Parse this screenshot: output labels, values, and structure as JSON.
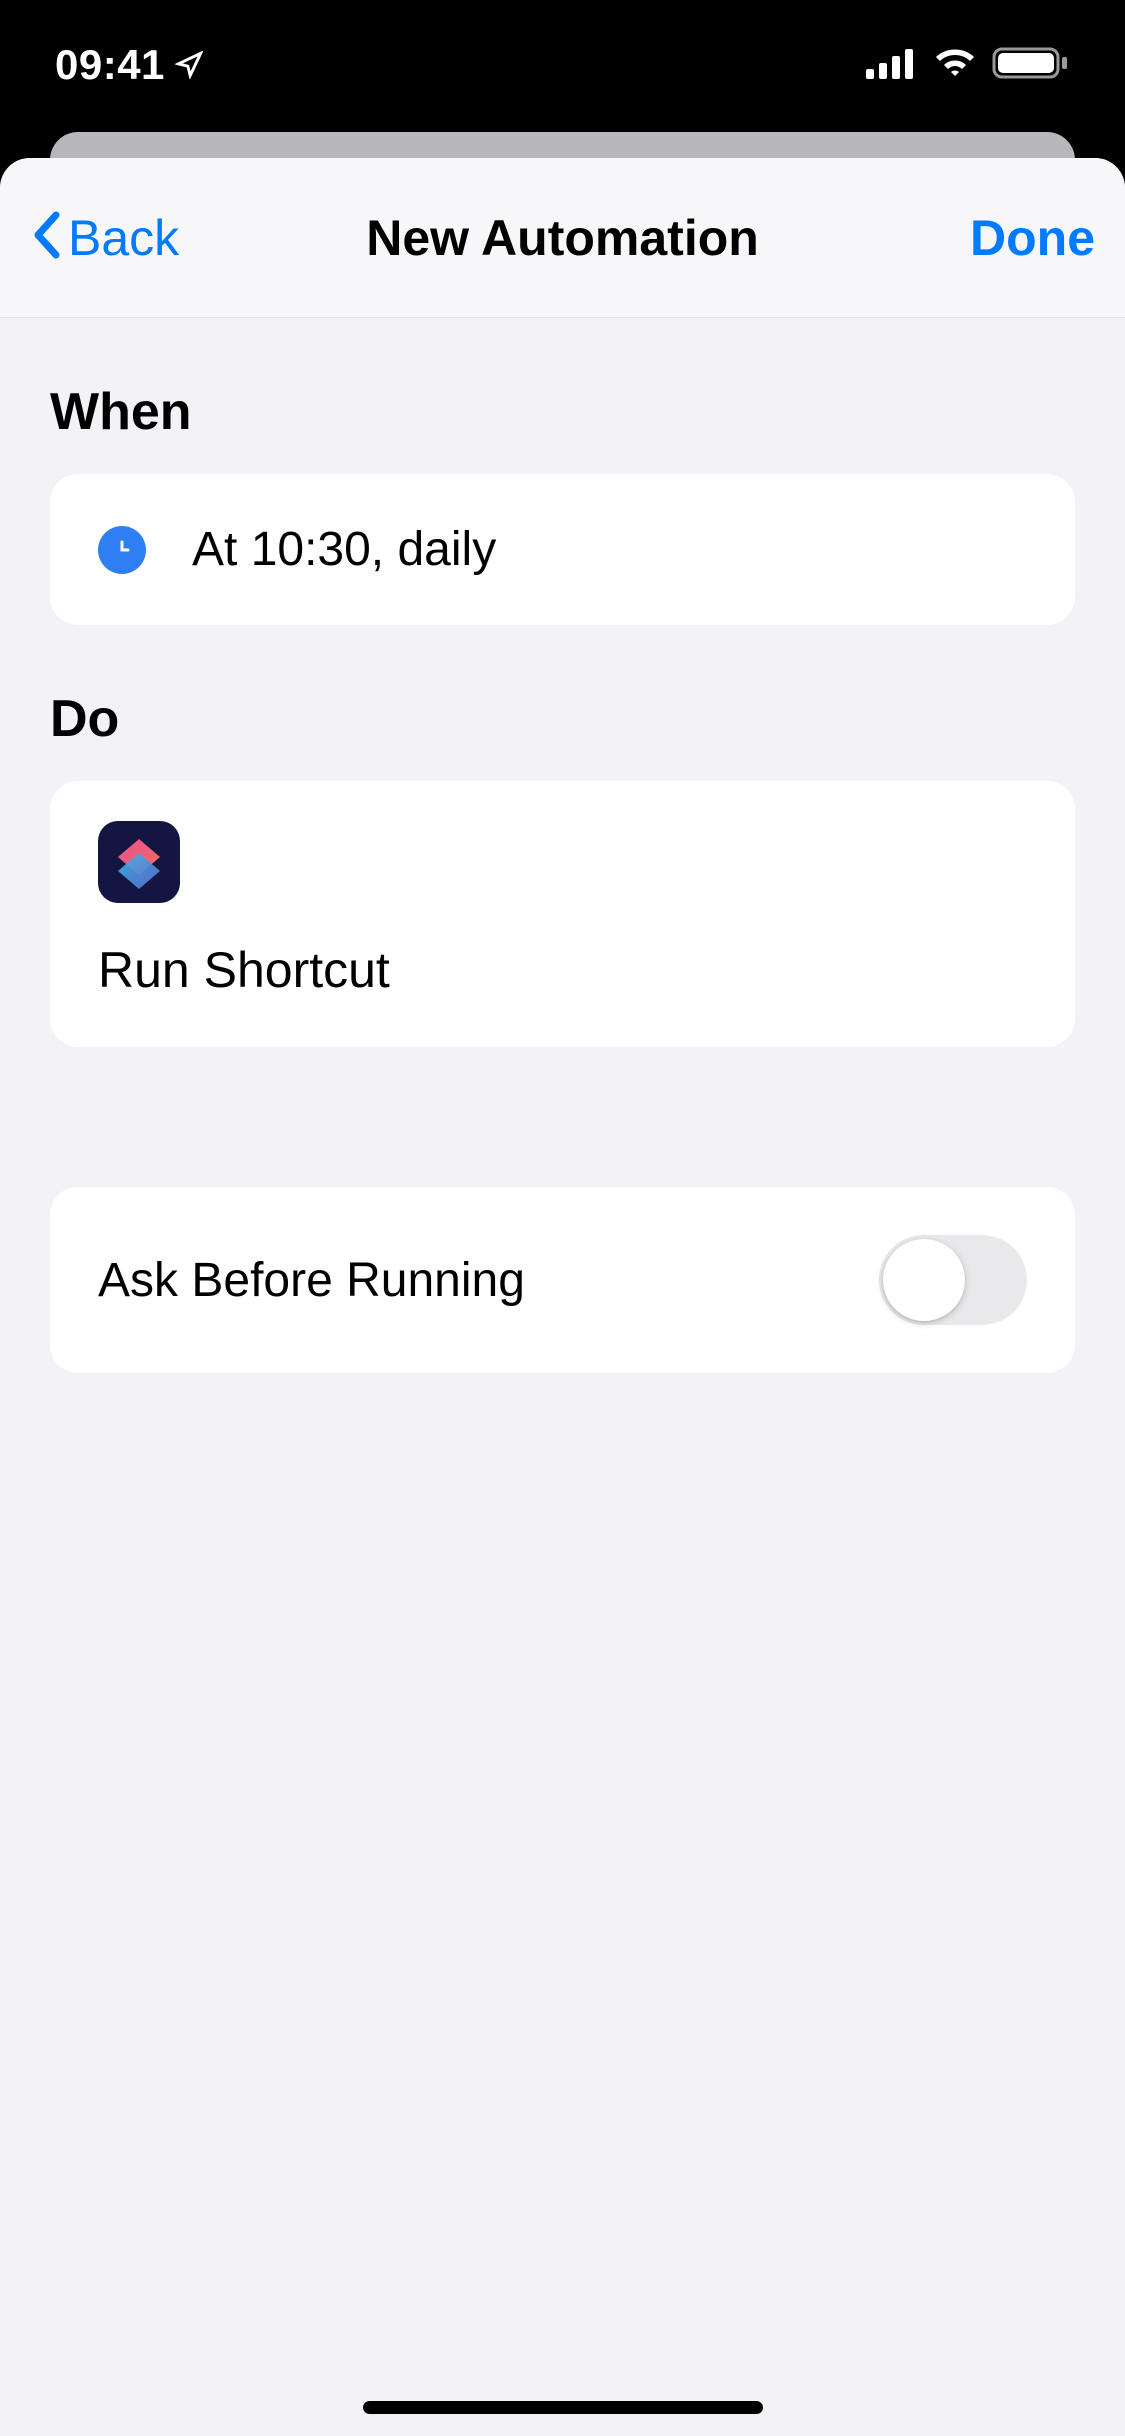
{
  "statusBar": {
    "time": "09:41"
  },
  "nav": {
    "back": "Back",
    "title": "New Automation",
    "done": "Done"
  },
  "sections": {
    "when": {
      "title": "When",
      "trigger": "At 10:30, daily"
    },
    "do": {
      "title": "Do",
      "action": "Run Shortcut"
    },
    "settings": {
      "askBeforeRunning": {
        "label": "Ask Before Running",
        "enabled": false
      }
    }
  }
}
